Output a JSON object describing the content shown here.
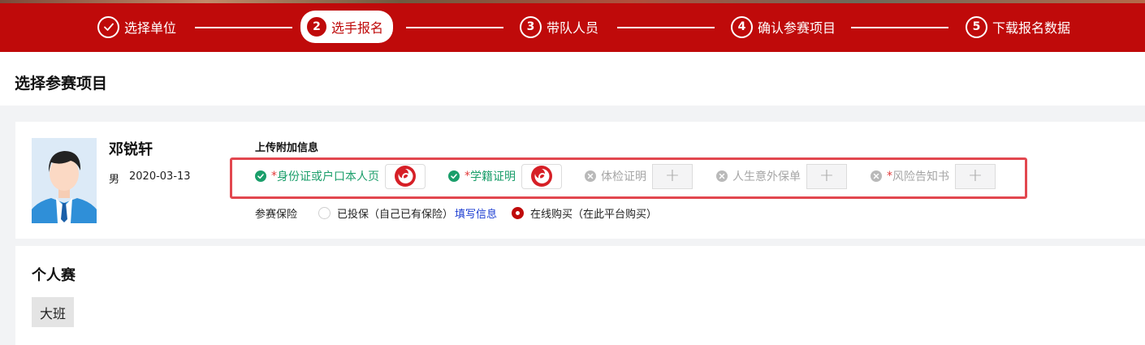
{
  "steps": [
    {
      "label": "选择单位",
      "num": "",
      "icon": "check-icon",
      "state": "done"
    },
    {
      "label": "选手报名",
      "num": "2",
      "state": "active"
    },
    {
      "label": "带队人员",
      "num": "3",
      "state": "todo"
    },
    {
      "label": "确认参赛项目",
      "num": "4",
      "state": "todo"
    },
    {
      "label": "下载报名数据",
      "num": "5",
      "state": "todo"
    }
  ],
  "page": {
    "title": "选择参赛项目"
  },
  "player": {
    "name": "邓锐轩",
    "gender": "男",
    "birthdate": "2020-03-13",
    "avatar_icon": "person-avatar-icon"
  },
  "uploads": {
    "label": "上传附加信息",
    "items": [
      {
        "required": "*",
        "label": "身份证或户口本人页",
        "status": "uploaded",
        "status_icon": "check-circle-icon",
        "preview": "logo-thumbnail"
      },
      {
        "required": "*",
        "label": "学籍证明",
        "status": "uploaded",
        "status_icon": "check-circle-icon",
        "preview": "logo-thumbnail"
      },
      {
        "required": "",
        "label": "体检证明",
        "status": "missing",
        "status_icon": "x-circle-icon",
        "preview": "+"
      },
      {
        "required": "",
        "label": "人生意外保单",
        "status": "missing",
        "status_icon": "x-circle-icon",
        "preview": "+"
      },
      {
        "required": "*",
        "label": "风险告知书",
        "status": "missing",
        "status_icon": "x-circle-icon",
        "preview": "+"
      }
    ]
  },
  "insurance": {
    "label": "参赛保险",
    "option1": "已投保（自己已有保险）",
    "fill_link": "填写信息",
    "option2": "在线购买（在此平台购买）",
    "selected": "option2"
  },
  "events": {
    "section_title": "个人赛",
    "tags": [
      "大班"
    ]
  },
  "colors": {
    "brand": "#bf0a0a",
    "success": "#1a9e6a",
    "highlight_border": "#e2474f",
    "link": "#1a3bd1"
  }
}
